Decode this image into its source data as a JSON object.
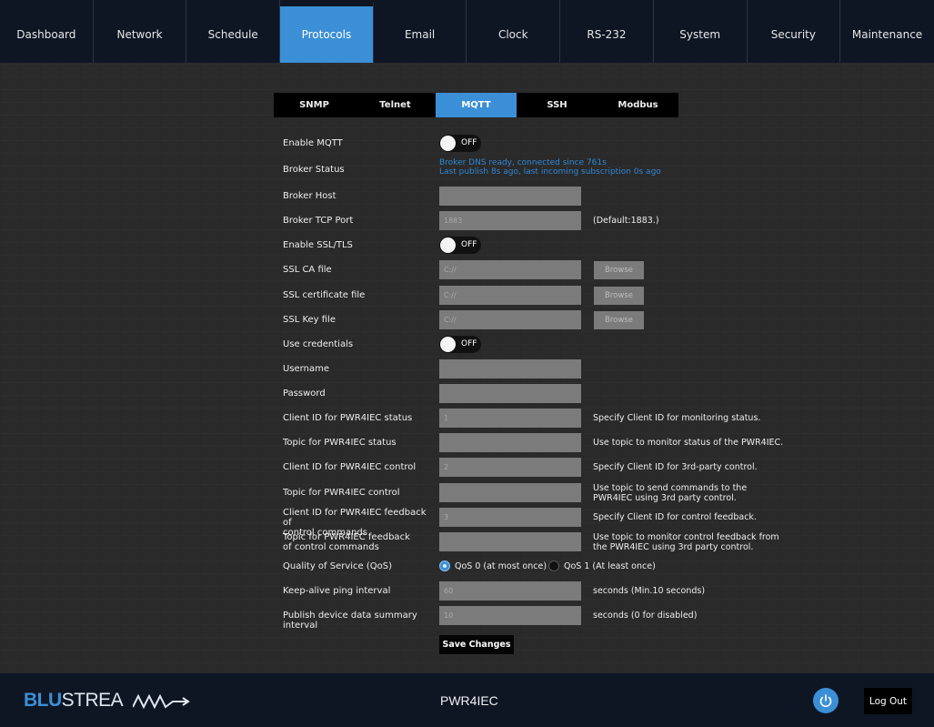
{
  "nav": {
    "items": [
      {
        "label": "Dashboard"
      },
      {
        "label": "Network"
      },
      {
        "label": "Schedule"
      },
      {
        "label": "Protocols"
      },
      {
        "label": "Email"
      },
      {
        "label": "Clock"
      },
      {
        "label": "RS-232"
      },
      {
        "label": "System"
      },
      {
        "label": "Security"
      },
      {
        "label": "Maintenance"
      }
    ],
    "active": "Protocols"
  },
  "subtabs": {
    "items": [
      {
        "label": "SNMP"
      },
      {
        "label": "Telnet"
      },
      {
        "label": "MQTT"
      },
      {
        "label": "SSH"
      },
      {
        "label": "Modbus"
      }
    ],
    "active": "MQTT"
  },
  "form": {
    "enable_mqtt": {
      "label": "Enable MQTT",
      "state": "OFF"
    },
    "broker_status": {
      "label": "Broker Status",
      "line1": "Broker DNS ready, connected since 761s",
      "line2": "Last publish 8s ago, last incoming subscription 0s ago"
    },
    "broker_host": {
      "label": "Broker Host",
      "value": ""
    },
    "broker_port": {
      "label": "Broker TCP Port",
      "placeholder": "1883",
      "hint": "(Default:1883.)"
    },
    "enable_ssl": {
      "label": "Enable SSL/TLS",
      "state": "OFF"
    },
    "ssl_ca": {
      "label": "SSL CA file",
      "placeholder": "C://",
      "button": "Browse"
    },
    "ssl_cert": {
      "label": "SSL certificate file",
      "placeholder": "C://",
      "button": "Browse"
    },
    "ssl_key": {
      "label": "SSL Key file",
      "placeholder": "C://",
      "button": "Browse"
    },
    "use_credentials": {
      "label": "Use credentials",
      "state": "OFF"
    },
    "username": {
      "label": "Username",
      "value": ""
    },
    "password": {
      "label": "Password",
      "value": ""
    },
    "client_status": {
      "label": "Client ID for PWR4IEC status",
      "placeholder": "1",
      "hint": "Specify Client ID for monitoring status."
    },
    "topic_status": {
      "label": "Topic for PWR4IEC status",
      "value": "",
      "hint": "Use topic to monitor status of the PWR4IEC."
    },
    "client_control": {
      "label": "Client ID for PWR4IEC control",
      "placeholder": "2",
      "hint": "Specify Client ID for 3rd-party control."
    },
    "topic_control": {
      "label": "Topic for PWR4IEC control",
      "value": "",
      "hint_line1": "Use topic to send commands to the",
      "hint_line2": "PWR4IEC using 3rd party control."
    },
    "client_feedback": {
      "label_line1": "Client ID for PWR4IEC feedback of",
      "label_line2": "control commands",
      "placeholder": "3",
      "hint": "Specify Client ID for control feedback."
    },
    "topic_feedback": {
      "label_line1": "Topic for PWR4IEC feedback",
      "label_line2": "of control commands",
      "value": "",
      "hint_line1": "Use topic to monitor control feedback from",
      "hint_line2": "the PWR4IEC using 3rd party control."
    },
    "qos": {
      "label": "Quality of Service (QoS)",
      "option0": "QoS 0 (at most once)",
      "option1": "QoS 1 (At least once)",
      "selected": "QoS 0 (at most once)"
    },
    "keepalive": {
      "label": "Keep-alive ping interval",
      "placeholder": "60",
      "hint": "seconds (Min.10 seconds)"
    },
    "publish_interval": {
      "label": "Publish device data summary interval",
      "placeholder": "10",
      "hint": "seconds (0 for disabled)"
    },
    "save_label": "Save Changes"
  },
  "footer": {
    "logo_blu": "BLU",
    "logo_stream": "STREA",
    "device_name": "PWR4IEC",
    "logout_label": "Log Out"
  },
  "colors": {
    "accent": "#3b8fd6",
    "nav_bg": "#0e1624",
    "field_bg": "#7b7b7b",
    "status_text": "#2f87d4"
  },
  "icons": {
    "power": "power-icon"
  }
}
